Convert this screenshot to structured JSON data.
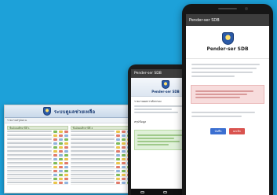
{
  "background_color": "#1da1d9",
  "desktop": {
    "banner_title": "ระบบดูแลช่วยเหลือ",
    "toolbar_text": "รายงานสรุปผล ▸",
    "left_column_header": "ชั้นมัธยมศึกษาปีที่ 1",
    "right_column_header": "ชั้นมัธยมศึกษาปีที่ 2",
    "row_count": 14
  },
  "phone_mid": {
    "appbar_title": "Pender-ser SDB",
    "banner_text": "Pender-ser SDB",
    "section_heading": "รายงานผลการคัดกรอง",
    "list_heading": "สรุปข้อมูล"
  },
  "phone_big": {
    "appbar_title": "Pender-ser SDB",
    "banner_text": "Pender-ser SDB",
    "button_primary": "บันทึก",
    "button_danger": "ยกเลิก"
  }
}
